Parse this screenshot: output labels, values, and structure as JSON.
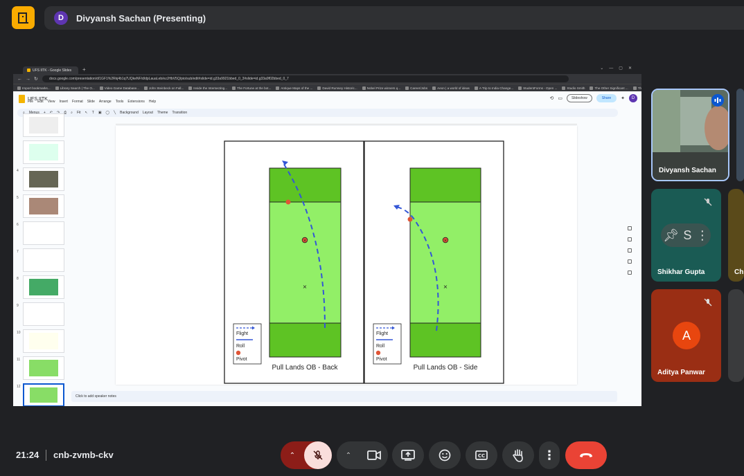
{
  "presenter": {
    "initial": "D",
    "label": "Divyansh Sachan (Presenting)"
  },
  "browser": {
    "tab_title": "UFS IITK - Google Slides",
    "url": "docs.google.com/presentation/d/1GF1%2Rkj4b1q7UQkeNF/d/dpLauaLeb/ezJHbV5Q/pio/sub/edit#slide=id.g33a9921bbed_0_3#slide=id.g33a9f02bbed_0_7",
    "bookmarks": [
      "Import bookmarks...",
      "Library Search | The O...",
      "Video Game Database...",
      "John Steinbeck on Fall...",
      "Inside the Intersecting...",
      "The Fortune at the bot...",
      "Antique Maps of the ...",
      "David Rumsey Historic...",
      "Nobel Prize winners q...",
      "Career/Jobs",
      "Aeon | a world of ideas",
      "A Trip to India Change...",
      "StudentForms - Open ...",
      "Studio Smith",
      "The Other Significant ...",
      "The Monarchs: Music..."
    ]
  },
  "slides_app": {
    "title": "UFS IITK",
    "menus": [
      "File",
      "Edit",
      "View",
      "Insert",
      "Format",
      "Slide",
      "Arrange",
      "Tools",
      "Extensions",
      "Help"
    ],
    "slideshow_label": "Slideshow",
    "share_label": "Share",
    "user_initial": "D",
    "toolbar": {
      "menus": "Menus",
      "fit": "Fit",
      "background": "Background",
      "layout": "Layout",
      "theme": "Theme",
      "transition": "Transition"
    },
    "thumb_numbers": [
      "",
      "",
      "4",
      "5",
      "6",
      "7",
      "8",
      "9",
      "10",
      "11",
      "12"
    ],
    "notes_placeholder": "Click to add speaker notes"
  },
  "slide": {
    "left_title": "Pull Lands OB - Back",
    "right_title": "Pull Lands OB - Side",
    "legend": {
      "flight": "Flight",
      "roll": "Roll",
      "pivot": "Pivot"
    }
  },
  "participants": [
    {
      "name": "Divyansh Sachan",
      "speaking": true
    },
    {
      "name": "Shikhar Gupta",
      "initial": "S",
      "muted": true
    },
    {
      "name": "Chi"
    },
    {
      "name": "Aditya Panwar",
      "initial": "A",
      "muted": true
    }
  ],
  "meeting": {
    "time": "21:24",
    "code": "cnb-zvmb-ckv"
  },
  "colors": {
    "accent_yellow": "#f9ab00",
    "end_call_red": "#ea4335",
    "mic_off_bg": "#f9dedc",
    "field_light": "#92ef67",
    "field_dark": "#5ec324",
    "path_blue": "#3356d6",
    "pivot_red": "#e05536"
  }
}
